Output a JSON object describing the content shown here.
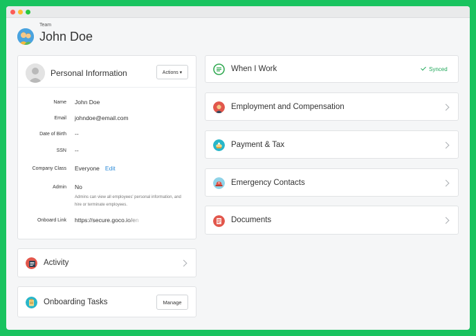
{
  "header": {
    "team_label": "Team",
    "user_name": "John Doe"
  },
  "personal_info": {
    "title": "Personal Information",
    "actions_label": "Actions ▾",
    "fields": [
      {
        "label": "Name",
        "value": "John Doe"
      },
      {
        "label": "Email",
        "value": "johndoe@email.com"
      },
      {
        "label": "Date of Birth",
        "value": "--"
      },
      {
        "label": "SSN",
        "value": "--"
      },
      {
        "label": "Company Class",
        "value": "Everyone",
        "link": "Edit"
      },
      {
        "label": "Admin",
        "value": "No",
        "note": "Admins can view all employees' personal information, and hire or terminate employees."
      },
      {
        "label": "Onboard Link",
        "value": "https://secure.goco.io/en"
      }
    ]
  },
  "activity": {
    "title": "Activity"
  },
  "onboarding": {
    "title": "Onboarding Tasks",
    "manage_label": "Manage"
  },
  "right_sections": [
    {
      "title": "When I Work",
      "status": "Synced",
      "icon": "when-i-work-icon"
    },
    {
      "title": "Employment and Compensation",
      "icon": "employment-icon"
    },
    {
      "title": "Payment & Tax",
      "icon": "payment-icon"
    },
    {
      "title": "Emergency Contacts",
      "icon": "emergency-icon"
    },
    {
      "title": "Documents",
      "icon": "documents-icon"
    }
  ],
  "colors": {
    "frame": "#19c35f",
    "link": "#2a8ad8",
    "synced": "#22a85b"
  }
}
